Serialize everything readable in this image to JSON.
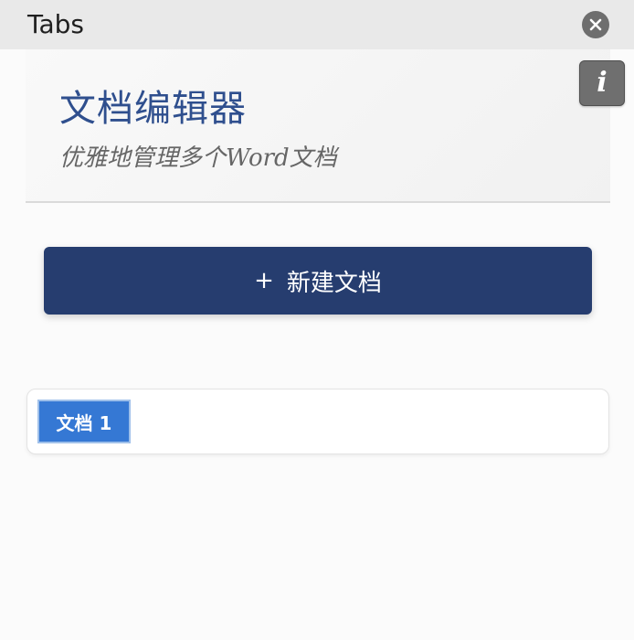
{
  "window": {
    "title": "Tabs",
    "close_icon": "close-icon"
  },
  "header": {
    "title": "文档编辑器",
    "subtitle": "优雅地管理多个Word文档"
  },
  "info_button": {
    "glyph": "i",
    "icon": "info-icon"
  },
  "new_document_button": {
    "plus": "+",
    "label": "新建文档"
  },
  "tabs": [
    {
      "label": "文档 1",
      "active": true
    }
  ],
  "colors": {
    "accent": "#263d6f",
    "title_blue": "#2f4f8e",
    "tab_active": "#3578d4"
  }
}
